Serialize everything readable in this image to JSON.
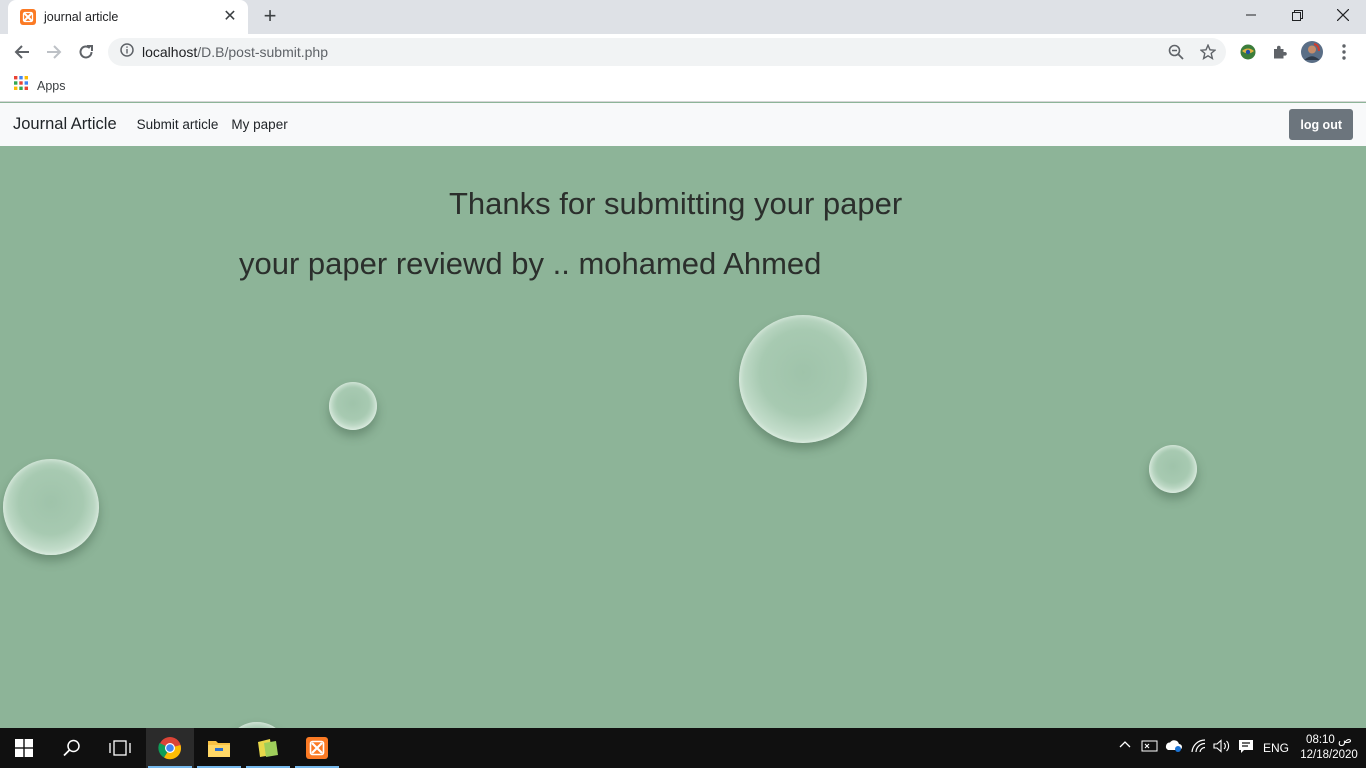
{
  "browser": {
    "tab_title": "journal article",
    "url_host": "localhost",
    "url_path": "/D.B/post-submit.php",
    "bookmarks_apps_label": "Apps"
  },
  "navbar": {
    "brand": "Journal Article",
    "links": [
      "Submit article",
      "My paper"
    ],
    "logout_label": "log out"
  },
  "main": {
    "heading": "Thanks for submitting your paper",
    "reviewer_text": "your paper reviewd by .. mohamed Ahmed"
  },
  "taskbar": {
    "language": "ENG",
    "time": "08:10 ص",
    "date": "12/18/2020"
  },
  "colors": {
    "page_background": "#8db498",
    "navbar_background": "#f8f9fa",
    "logout_button": "#6c757d",
    "taskbar": "#101010"
  },
  "icons": [
    "xampp-icon",
    "close-icon",
    "plus-icon",
    "minimize-icon",
    "restore-icon",
    "back-arrow-icon",
    "forward-arrow-icon",
    "reload-icon",
    "info-icon",
    "zoom-icon",
    "star-icon",
    "extension-icon",
    "puzzle-icon",
    "profile-avatar",
    "more-vert-icon",
    "apps-grid-icon",
    "windows-start-icon",
    "search-icon",
    "task-view-icon",
    "chrome-icon",
    "file-explorer-icon",
    "notes-icon",
    "chevron-up-icon",
    "network-icon",
    "wifi-icon",
    "volume-icon",
    "notification-icon"
  ]
}
